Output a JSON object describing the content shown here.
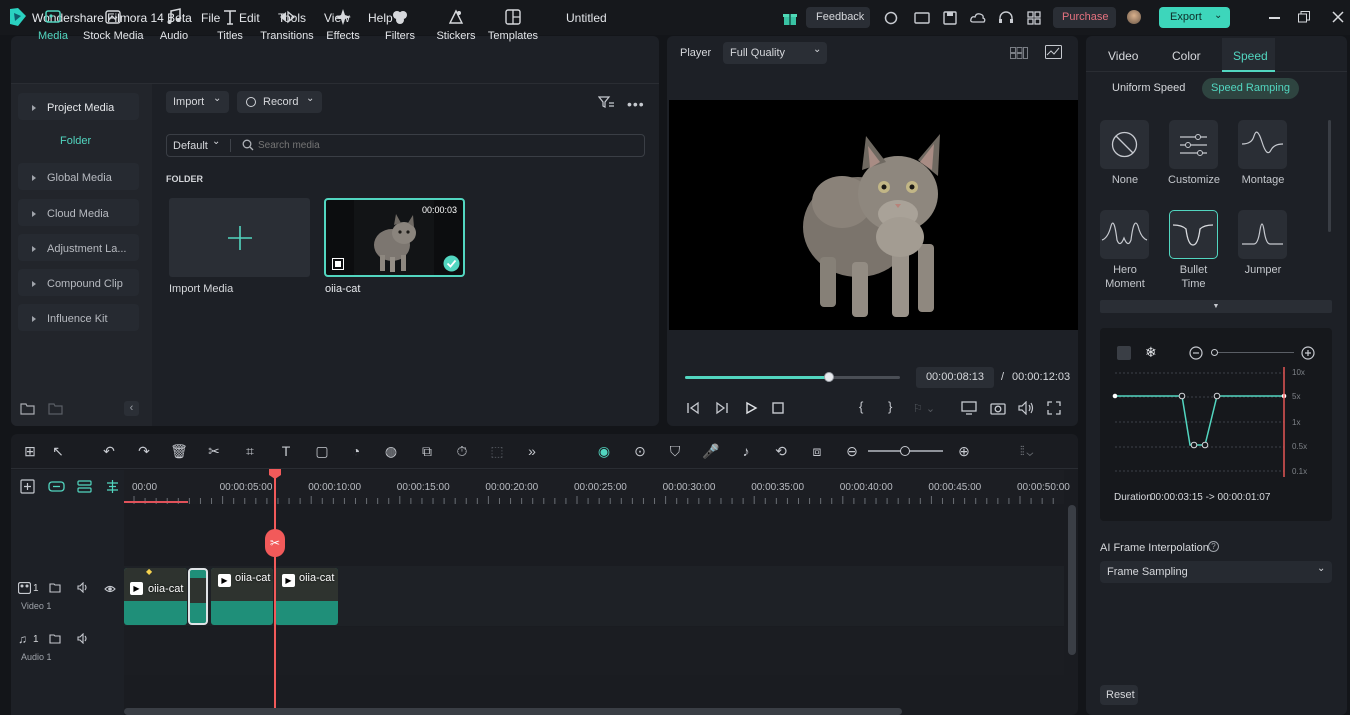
{
  "app": {
    "title": "Wondershare Filmora 14 Beta",
    "doc_title": "Untitled",
    "menu": [
      "File",
      "Edit",
      "Tools",
      "View",
      "Help"
    ],
    "feedback": "Feedback",
    "purchase": "Purchase",
    "export": "Export"
  },
  "media_tabs": [
    {
      "label": "Media",
      "icon": "media-icon"
    },
    {
      "label": "Stock Media",
      "icon": "stock-media-icon"
    },
    {
      "label": "Audio",
      "icon": "audio-icon"
    },
    {
      "label": "Titles",
      "icon": "titles-icon"
    },
    {
      "label": "Transitions",
      "icon": "transitions-icon"
    },
    {
      "label": "Effects",
      "icon": "effects-icon"
    },
    {
      "label": "Filters",
      "icon": "filters-icon"
    },
    {
      "label": "Stickers",
      "icon": "stickers-icon"
    },
    {
      "label": "Templates",
      "icon": "templates-icon"
    }
  ],
  "sidebar": {
    "project_media": "Project Media",
    "folder": "Folder",
    "items": [
      "Global Media",
      "Cloud Media",
      "Adjustment La...",
      "Compound Clip",
      "Influence Kit"
    ]
  },
  "media": {
    "import": "Import",
    "record": "Record",
    "sort": "Default",
    "search_placeholder": "Search media",
    "folder_heading": "FOLDER",
    "import_media": "Import Media",
    "clip_name": "oiia-cat",
    "clip_duration": "00:00:03"
  },
  "player": {
    "label": "Player",
    "quality": "Full Quality",
    "current": "00:00:08:13",
    "separator": "/",
    "total": "00:00:12:03",
    "progress": 0.67
  },
  "timeline": {
    "ticks": [
      "00:00",
      "00:00:05:00",
      "00:00:10:00",
      "00:00:15:00",
      "00:00:20:00",
      "00:00:25:00",
      "00:00:30:00",
      "00:00:35:00",
      "00:00:40:00",
      "00:00:45:00",
      "00:00:50:00"
    ],
    "video_track": "Video 1",
    "audio_track": "Audio 1",
    "video_num": "1",
    "audio_num": "1",
    "clip_names": [
      "oiia-cat",
      "oiia-cat",
      "oiia-cat"
    ]
  },
  "speed": {
    "tabs": [
      "Video",
      "Color",
      "Speed"
    ],
    "active_tab": "Speed",
    "subtabs": [
      "Uniform Speed",
      "Speed Ramping"
    ],
    "active_subtab": "Speed Ramping",
    "presets": [
      "None",
      "Customize",
      "Montage",
      "Hero Moment",
      "Bullet Time",
      "Jumper"
    ],
    "selected_preset": "Bullet Time",
    "y_ticks": [
      "10x",
      "5x",
      "1x",
      "0.5x",
      "0.1x"
    ],
    "duration_label": "Duration",
    "duration_value": "00:00:03:15 -> 00:00:01:07",
    "ai_label": "AI Frame Interpolation",
    "frame_mode": "Frame Sampling",
    "reset": "Reset"
  },
  "colors": {
    "accent": "#52d6c0",
    "purchase": "#e5727f",
    "export_bg": "#3dd6bb",
    "playhead": "#f25a5a"
  }
}
